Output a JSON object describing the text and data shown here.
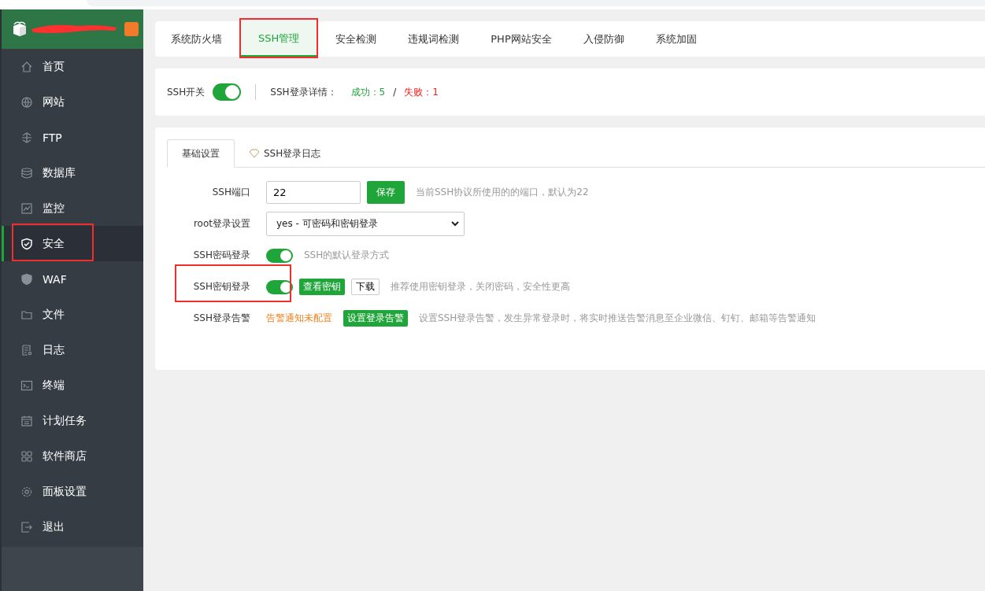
{
  "sidebar": {
    "items": [
      {
        "label": "首页",
        "selected": false
      },
      {
        "label": "网站",
        "selected": false
      },
      {
        "label": "FTP",
        "selected": false
      },
      {
        "label": "数据库",
        "selected": false
      },
      {
        "label": "监控",
        "selected": false
      },
      {
        "label": "安全",
        "selected": true
      },
      {
        "label": "WAF",
        "selected": false
      },
      {
        "label": "文件",
        "selected": false
      },
      {
        "label": "日志",
        "selected": false
      },
      {
        "label": "终端",
        "selected": false
      },
      {
        "label": "计划任务",
        "selected": false
      },
      {
        "label": "软件商店",
        "selected": false
      },
      {
        "label": "面板设置",
        "selected": false
      },
      {
        "label": "退出",
        "selected": false
      }
    ]
  },
  "tabs": [
    {
      "label": "系统防火墙",
      "selected": false
    },
    {
      "label": "SSH管理",
      "selected": true
    },
    {
      "label": "安全检测",
      "selected": false
    },
    {
      "label": "违规词检测",
      "selected": false
    },
    {
      "label": "PHP网站安全",
      "selected": false
    },
    {
      "label": "入侵防御",
      "selected": false
    },
    {
      "label": "系统加固",
      "selected": false
    }
  ],
  "status": {
    "switch_label": "SSH开关",
    "on": true,
    "details_label": "SSH登录详情：",
    "success": "成功：5",
    "separator": "/",
    "fail": "失败：1"
  },
  "subtabs": [
    {
      "label": "基础设置",
      "selected": true
    },
    {
      "label": "SSH登录日志",
      "selected": false
    }
  ],
  "settings": [
    {
      "kind": "input",
      "label": "SSH端口",
      "value": "22",
      "button": "保存",
      "hint": "当前SSH协议所使用的的端口，默认为22"
    },
    {
      "kind": "select",
      "label": "root登录设置",
      "value": "yes - 可密码和密钥登录"
    },
    {
      "kind": "toggle",
      "label": "SSH密码登录",
      "on": true,
      "hint": "SSH的默认登录方式"
    },
    {
      "kind": "toggle",
      "label": "SSH密钥登录",
      "on": true,
      "button": "查看密钥",
      "button2": "下载",
      "hint": "推荐使用密钥登录，关闭密码，安全性更高"
    },
    {
      "kind": "alert",
      "label": "SSH登录告警",
      "warning": "告警通知未配置",
      "button": "设置登录告警",
      "hint": "设置SSH登录告警，发生异常登录时，将实时推送告警消息至企业微信、钉钉、邮箱等告警通知"
    }
  ]
}
